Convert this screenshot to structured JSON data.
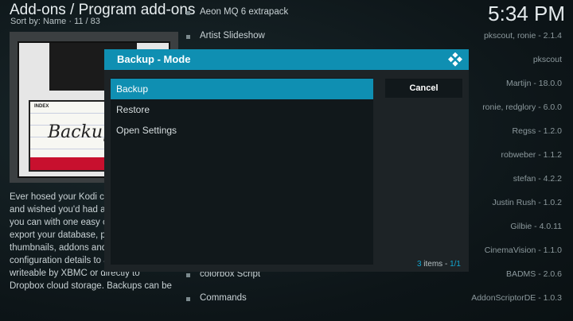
{
  "header": {
    "title": "Add-ons / Program add-ons",
    "sort_label": "Sort by: Name · 11 / 83",
    "clock": "5:34 PM"
  },
  "thumbnail": {
    "label_index": "INDEX",
    "label_hand": "Backup"
  },
  "description_lines": [
    "Ever hosed your Kodi co",
    "and wished you'd had a",
    "you can with one easy c",
    "export your database, pl",
    "thumbnails, addons and",
    "configuration details to a",
    "writeable by XBMC or directly to",
    "Dropbox cloud storage. Backups can be"
  ],
  "addon_list": [
    {
      "name": "Aeon MQ 6 extrapack",
      "author": ""
    },
    {
      "name": "Artist Slideshow",
      "author": "pkscout, ronie - 2.1.4"
    },
    {
      "name": "",
      "author": "pkscout"
    },
    {
      "name": "",
      "author": "Martijn - 18.0.0"
    },
    {
      "name": "",
      "author": "ronie, redglory - 6.0.0"
    },
    {
      "name": "",
      "author": "Regss - 1.2.0"
    },
    {
      "name": "",
      "author": "robweber - 1.1.2"
    },
    {
      "name": "",
      "author": "stefan - 4.2.2"
    },
    {
      "name": "",
      "author": "Justin Rush - 1.0.2"
    },
    {
      "name": "",
      "author": "Gilbie - 4.0.11"
    },
    {
      "name": "",
      "author": "CinemaVision - 1.1.0"
    },
    {
      "name": "colorbox Script",
      "author": "BADMS - 2.0.6"
    },
    {
      "name": "Commands",
      "author": "AddonScriptorDE - 1.0.3"
    }
  ],
  "dialog": {
    "title": "Backup - Mode",
    "options": [
      "Backup",
      "Restore",
      "Open Settings"
    ],
    "selected_index": 0,
    "cancel_label": "Cancel",
    "items_count": "3",
    "items_word": "items",
    "page": "1/1"
  },
  "colors": {
    "accent": "#0f8fb2",
    "dialog_bg": "#1d2326",
    "list_bg": "#11181b"
  }
}
